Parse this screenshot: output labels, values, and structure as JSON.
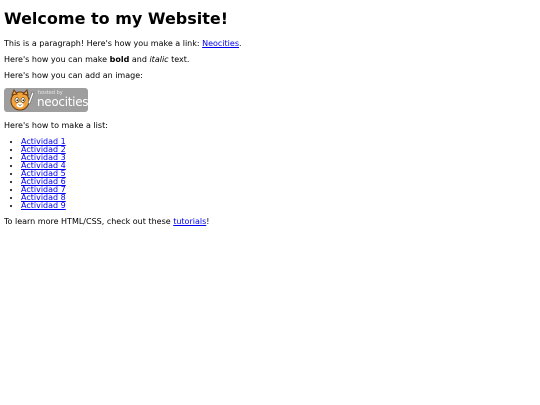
{
  "heading": "Welcome to my Website!",
  "intro": {
    "before": "This is a paragraph! Here's how you make a link: ",
    "link": "Neocities",
    "after": "."
  },
  "formatting": {
    "before": "Here's how you can make ",
    "bold": "bold",
    "middle": " and ",
    "italic": "italic",
    "after": " text."
  },
  "image_intro": "Here's how you can add an image:",
  "badge": {
    "hosted": "hosted by",
    "brand": "neocities",
    "icon": "neocities-cat-logo"
  },
  "list_intro": "Here's how to make a list:",
  "list": [
    "Actividad 1",
    "Actividad 2",
    "Actividad 3",
    "Actividad 4",
    "Actividad 5",
    "Actividad 6",
    "Actividad 7",
    "Actividad 8",
    "Actividad 9"
  ],
  "outro": {
    "before": "To learn more HTML/CSS, check out these ",
    "link": "tutorials",
    "after": "!"
  },
  "colors": {
    "link": "#0000ee",
    "badge_bg": "#9e9e9e",
    "cat_orange": "#f2a33a"
  }
}
